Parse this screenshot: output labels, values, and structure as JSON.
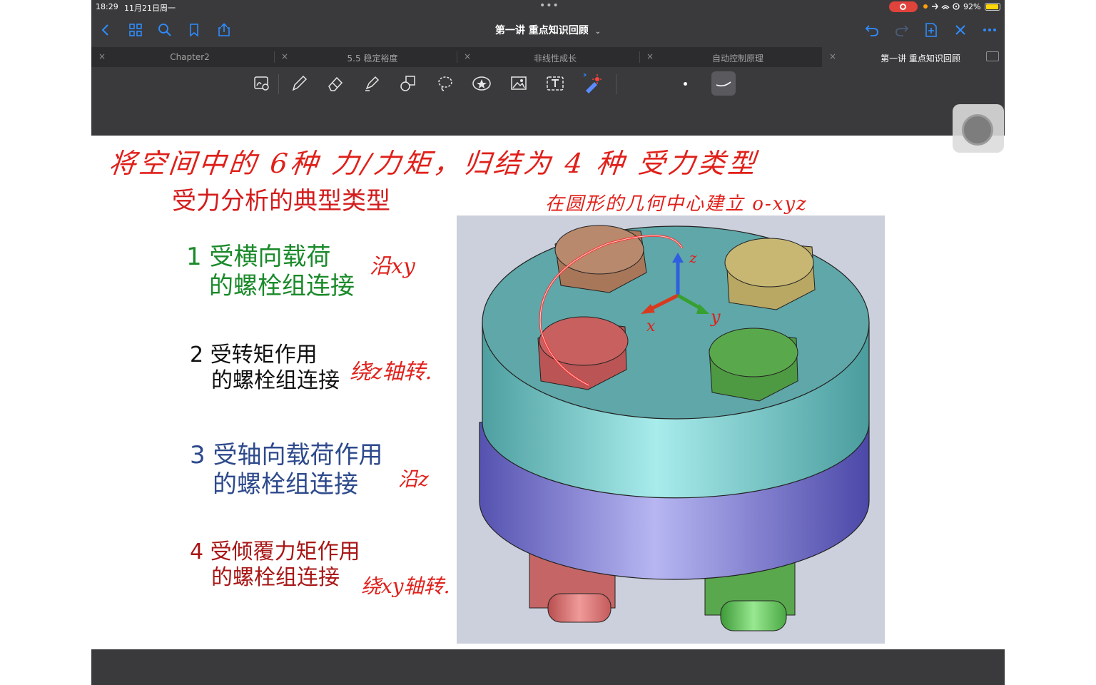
{
  "status_bar": {
    "time": "18:29",
    "date": "11月21日周一",
    "battery": "92%",
    "battery_level": 0.92
  },
  "nav": {
    "document_title": "第一讲  重点知识回顾"
  },
  "tabs": [
    {
      "label": "Chapter2"
    },
    {
      "label": "5.5 稳定裕度"
    },
    {
      "label": "非线性成长"
    },
    {
      "label": "自动控制原理"
    },
    {
      "label": "第一讲  重点知识回顾"
    }
  ],
  "colors": {
    "accent": "#2f8cff",
    "title_red": "#d41c1c",
    "ink_red": "#e0201a",
    "item1": "#1a8a2a",
    "item3": "#2e4a8c",
    "item4": "#a81616"
  },
  "slide": {
    "title": "受力分析的典型类型",
    "items": [
      {
        "number": "1",
        "line1": "受横向载荷",
        "line2": "的螺栓组连接"
      },
      {
        "number": "2",
        "line1": "受转矩作用",
        "line2": "的螺栓组连接"
      },
      {
        "number": "3",
        "line1": "受轴向载荷作用",
        "line2": "的螺栓组连接"
      },
      {
        "number": "4",
        "line1": "受倾覆力矩作用",
        "line2": "的螺栓组连接"
      }
    ]
  },
  "handwriting": {
    "top": "将空间中的 6种 力/力矩，归结为 4 种 受力类型",
    "origin": "在圆形的几何中心建立 o-xyz",
    "note1": "沿xy",
    "note2": "绕z轴转.",
    "note3": "沿z",
    "note4": "绕xy轴转.",
    "axis_x": "x",
    "axis_y": "y",
    "axis_z": "z"
  },
  "icons": {
    "nav_left": [
      "back-icon",
      "grid-icon",
      "search-icon",
      "bookmark-icon",
      "share-icon"
    ],
    "nav_right": [
      "undo-icon",
      "redo-icon",
      "add-page-icon",
      "close-icon",
      "more-icon"
    ],
    "tools": [
      "ocr-icon",
      "pen-icon",
      "eraser-icon",
      "highlighter-icon",
      "shapes-icon",
      "lasso-icon",
      "sticker-icon",
      "image-icon",
      "text-icon",
      "laser-pointer-icon",
      "dot-size-icon",
      "stroke-style-icon"
    ]
  }
}
